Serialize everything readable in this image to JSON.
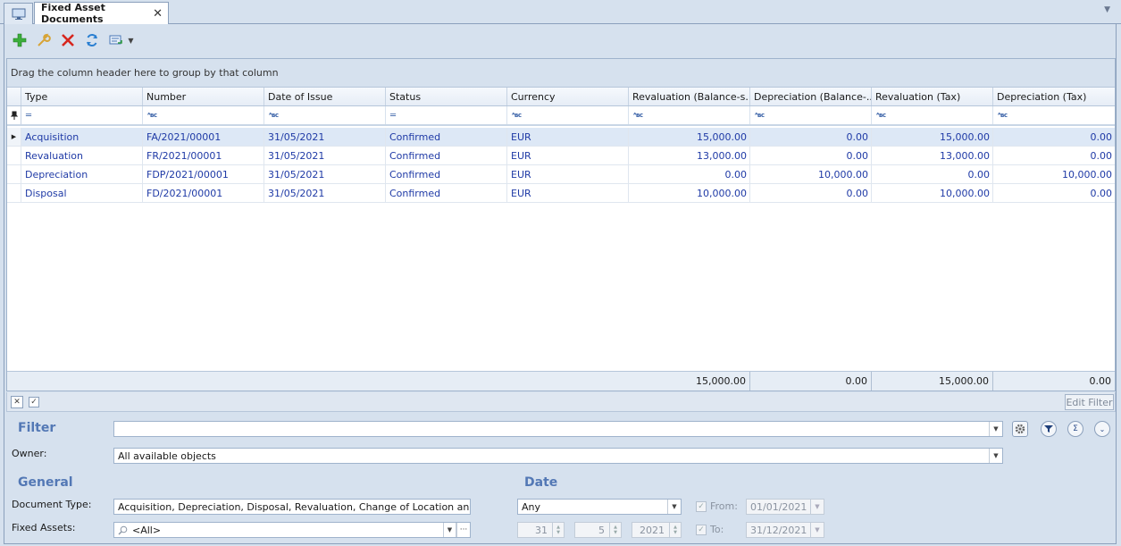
{
  "tabs": {
    "home_icon": "monitor-icon",
    "active_label": "Fixed Asset Documents",
    "close_glyph": "✕"
  },
  "toolbar": {
    "buttons": [
      "add-icon",
      "edit-icon",
      "delete-icon",
      "refresh-icon",
      "export-icon"
    ]
  },
  "grid": {
    "group_panel_text": "Drag the column header here to group by that column",
    "columns": [
      "Type",
      "Number",
      "Date of Issue",
      "Status",
      "Currency",
      "Revaluation (Balance-s...",
      "Depreciation (Balance-...",
      "Revaluation (Tax)",
      "Depreciation (Tax)"
    ],
    "rows": [
      [
        "Acquisition",
        "FA/2021/00001",
        "31/05/2021",
        "Confirmed",
        "EUR",
        "15,000.00",
        "0.00",
        "15,000.00",
        "0.00"
      ],
      [
        "Revaluation",
        "FR/2021/00001",
        "31/05/2021",
        "Confirmed",
        "EUR",
        "13,000.00",
        "0.00",
        "13,000.00",
        "0.00"
      ],
      [
        "Depreciation",
        "FDP/2021/00001",
        "31/05/2021",
        "Confirmed",
        "EUR",
        "0.00",
        "10,000.00",
        "0.00",
        "10,000.00"
      ],
      [
        "Disposal",
        "FD/2021/00001",
        "31/05/2021",
        "Confirmed",
        "EUR",
        "10,000.00",
        "0.00",
        "10,000.00",
        "0.00"
      ]
    ],
    "totals": {
      "revaluation_bs": "15,000.00",
      "depreciation_bs": "0.00",
      "revaluation_tax": "15,000.00",
      "depreciation_tax": "0.00"
    },
    "edit_filter_label": "Edit Filter"
  },
  "filter": {
    "title": "Filter",
    "value": "",
    "owner_label": "Owner:",
    "owner_value": "All available objects"
  },
  "general": {
    "title": "General",
    "doc_type_label": "Document Type:",
    "doc_type_value": "Acquisition, Depreciation, Disposal, Revaluation, Change of Location and ...",
    "fixed_assets_label": "Fixed Assets:",
    "fixed_assets_value": "<All>"
  },
  "date": {
    "title": "Date",
    "period_value": "Any",
    "from_label": "From:",
    "from_value": "01/01/2021",
    "to_label": "To:",
    "to_value": "31/12/2021",
    "day": "31",
    "month": "5",
    "year": "2021"
  }
}
